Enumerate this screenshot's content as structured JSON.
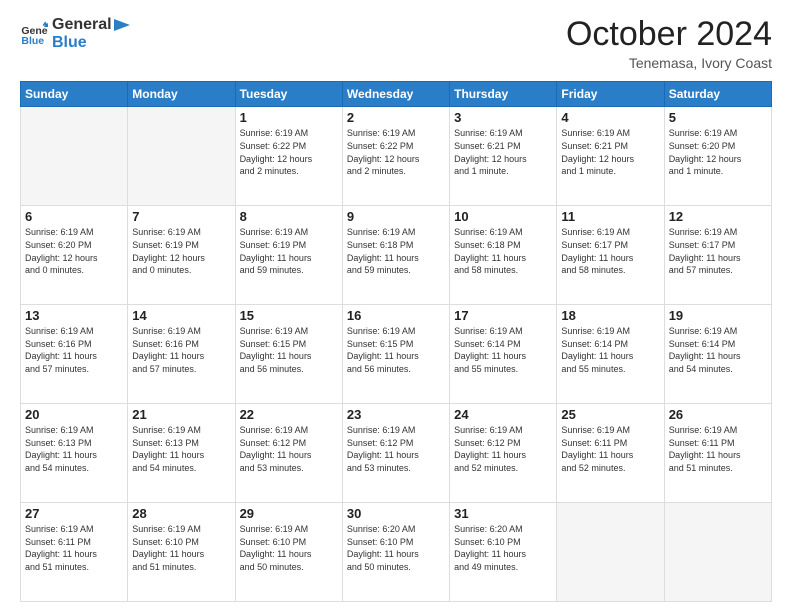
{
  "header": {
    "logo_line1": "General",
    "logo_line2": "Blue",
    "month": "October 2024",
    "location": "Tenemasa, Ivory Coast"
  },
  "weekdays": [
    "Sunday",
    "Monday",
    "Tuesday",
    "Wednesday",
    "Thursday",
    "Friday",
    "Saturday"
  ],
  "weeks": [
    [
      {
        "day": "",
        "info": ""
      },
      {
        "day": "",
        "info": ""
      },
      {
        "day": "1",
        "info": "Sunrise: 6:19 AM\nSunset: 6:22 PM\nDaylight: 12 hours\nand 2 minutes."
      },
      {
        "day": "2",
        "info": "Sunrise: 6:19 AM\nSunset: 6:22 PM\nDaylight: 12 hours\nand 2 minutes."
      },
      {
        "day": "3",
        "info": "Sunrise: 6:19 AM\nSunset: 6:21 PM\nDaylight: 12 hours\nand 1 minute."
      },
      {
        "day": "4",
        "info": "Sunrise: 6:19 AM\nSunset: 6:21 PM\nDaylight: 12 hours\nand 1 minute."
      },
      {
        "day": "5",
        "info": "Sunrise: 6:19 AM\nSunset: 6:20 PM\nDaylight: 12 hours\nand 1 minute."
      }
    ],
    [
      {
        "day": "6",
        "info": "Sunrise: 6:19 AM\nSunset: 6:20 PM\nDaylight: 12 hours\nand 0 minutes."
      },
      {
        "day": "7",
        "info": "Sunrise: 6:19 AM\nSunset: 6:19 PM\nDaylight: 12 hours\nand 0 minutes."
      },
      {
        "day": "8",
        "info": "Sunrise: 6:19 AM\nSunset: 6:19 PM\nDaylight: 11 hours\nand 59 minutes."
      },
      {
        "day": "9",
        "info": "Sunrise: 6:19 AM\nSunset: 6:18 PM\nDaylight: 11 hours\nand 59 minutes."
      },
      {
        "day": "10",
        "info": "Sunrise: 6:19 AM\nSunset: 6:18 PM\nDaylight: 11 hours\nand 58 minutes."
      },
      {
        "day": "11",
        "info": "Sunrise: 6:19 AM\nSunset: 6:17 PM\nDaylight: 11 hours\nand 58 minutes."
      },
      {
        "day": "12",
        "info": "Sunrise: 6:19 AM\nSunset: 6:17 PM\nDaylight: 11 hours\nand 57 minutes."
      }
    ],
    [
      {
        "day": "13",
        "info": "Sunrise: 6:19 AM\nSunset: 6:16 PM\nDaylight: 11 hours\nand 57 minutes."
      },
      {
        "day": "14",
        "info": "Sunrise: 6:19 AM\nSunset: 6:16 PM\nDaylight: 11 hours\nand 57 minutes."
      },
      {
        "day": "15",
        "info": "Sunrise: 6:19 AM\nSunset: 6:15 PM\nDaylight: 11 hours\nand 56 minutes."
      },
      {
        "day": "16",
        "info": "Sunrise: 6:19 AM\nSunset: 6:15 PM\nDaylight: 11 hours\nand 56 minutes."
      },
      {
        "day": "17",
        "info": "Sunrise: 6:19 AM\nSunset: 6:14 PM\nDaylight: 11 hours\nand 55 minutes."
      },
      {
        "day": "18",
        "info": "Sunrise: 6:19 AM\nSunset: 6:14 PM\nDaylight: 11 hours\nand 55 minutes."
      },
      {
        "day": "19",
        "info": "Sunrise: 6:19 AM\nSunset: 6:14 PM\nDaylight: 11 hours\nand 54 minutes."
      }
    ],
    [
      {
        "day": "20",
        "info": "Sunrise: 6:19 AM\nSunset: 6:13 PM\nDaylight: 11 hours\nand 54 minutes."
      },
      {
        "day": "21",
        "info": "Sunrise: 6:19 AM\nSunset: 6:13 PM\nDaylight: 11 hours\nand 54 minutes."
      },
      {
        "day": "22",
        "info": "Sunrise: 6:19 AM\nSunset: 6:12 PM\nDaylight: 11 hours\nand 53 minutes."
      },
      {
        "day": "23",
        "info": "Sunrise: 6:19 AM\nSunset: 6:12 PM\nDaylight: 11 hours\nand 53 minutes."
      },
      {
        "day": "24",
        "info": "Sunrise: 6:19 AM\nSunset: 6:12 PM\nDaylight: 11 hours\nand 52 minutes."
      },
      {
        "day": "25",
        "info": "Sunrise: 6:19 AM\nSunset: 6:11 PM\nDaylight: 11 hours\nand 52 minutes."
      },
      {
        "day": "26",
        "info": "Sunrise: 6:19 AM\nSunset: 6:11 PM\nDaylight: 11 hours\nand 51 minutes."
      }
    ],
    [
      {
        "day": "27",
        "info": "Sunrise: 6:19 AM\nSunset: 6:11 PM\nDaylight: 11 hours\nand 51 minutes."
      },
      {
        "day": "28",
        "info": "Sunrise: 6:19 AM\nSunset: 6:10 PM\nDaylight: 11 hours\nand 51 minutes."
      },
      {
        "day": "29",
        "info": "Sunrise: 6:19 AM\nSunset: 6:10 PM\nDaylight: 11 hours\nand 50 minutes."
      },
      {
        "day": "30",
        "info": "Sunrise: 6:20 AM\nSunset: 6:10 PM\nDaylight: 11 hours\nand 50 minutes."
      },
      {
        "day": "31",
        "info": "Sunrise: 6:20 AM\nSunset: 6:10 PM\nDaylight: 11 hours\nand 49 minutes."
      },
      {
        "day": "",
        "info": ""
      },
      {
        "day": "",
        "info": ""
      }
    ]
  ]
}
